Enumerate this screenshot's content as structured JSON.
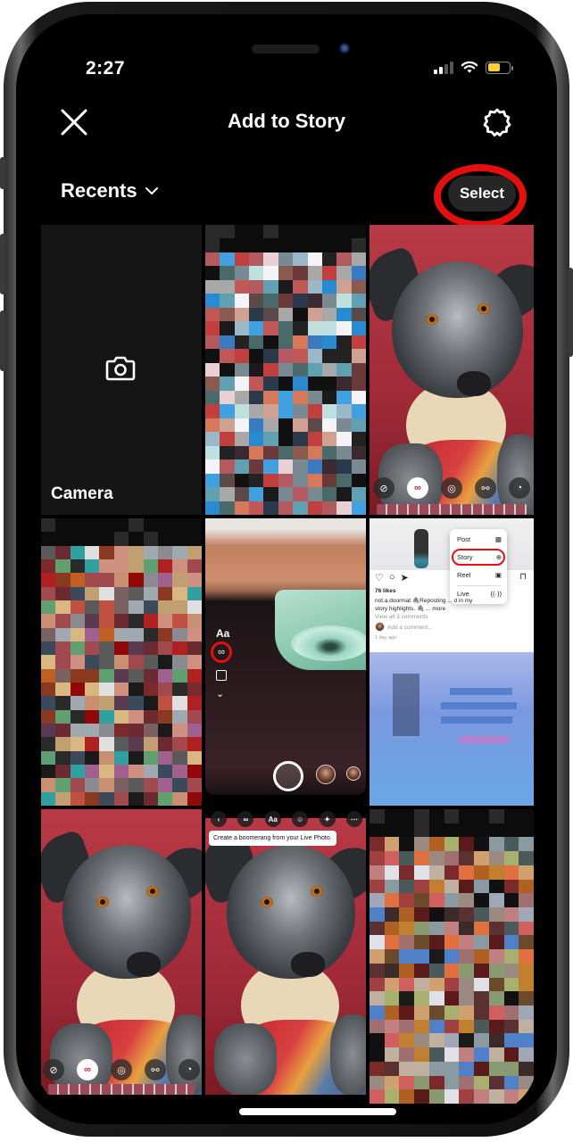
{
  "status_bar": {
    "time": "2:27",
    "signal_bars": 2,
    "signal_bars_total": 4,
    "wifi_icon": "wifi-icon",
    "battery_level": 0.6,
    "battery_color": "#f5d03b"
  },
  "header": {
    "close_icon": "close-icon",
    "title": "Add to Story",
    "settings_icon": "gear-icon"
  },
  "toolbar": {
    "album_label": "Recents",
    "album_chevron": "chevron-down-icon",
    "select_label": "Select",
    "highlight_color": "#e41010"
  },
  "grid": {
    "camera_tile": {
      "icon": "camera-icon",
      "label": "Camera"
    },
    "tiles": [
      {
        "id": "blurred-screenshot-1",
        "kind": "pixelated"
      },
      {
        "id": "dog-photo-1",
        "kind": "photo",
        "has_effect_bar": true
      },
      {
        "id": "blurred-screenshot-2",
        "kind": "pixelated"
      },
      {
        "id": "story-camera-screenshot",
        "kind": "screenshot"
      },
      {
        "id": "instagram-post-screenshot",
        "kind": "screenshot"
      },
      {
        "id": "dog-photo-2",
        "kind": "photo",
        "has_effect_bar": true
      },
      {
        "id": "dog-photo-tooltip",
        "kind": "screenshot"
      },
      {
        "id": "blurred-screenshot-3",
        "kind": "pixelated"
      }
    ],
    "effect_pills": [
      "⊘",
      "∞",
      "◎",
      "⚯",
      "◔"
    ],
    "story_camera": {
      "text_tool": "Aa",
      "boomerang_glyph": "∞",
      "chevron": "⌄"
    },
    "instagram_post": {
      "menu_items": [
        {
          "label": "Post",
          "icon": "grid-icon"
        },
        {
          "label": "Story",
          "icon": "story-plus-icon"
        },
        {
          "label": "Reel",
          "icon": "reel-icon"
        },
        {
          "label": "Live",
          "icon": "live-icon"
        }
      ],
      "likes": "76 likes",
      "caption_user": "not.a.doormat",
      "caption_line1": "not.a.doormat 🖇Reposting ... d in my",
      "caption_line2": "story highlights. 🖇 ... more",
      "comments_link": "View all 3 comments",
      "comment_placeholder": "Add a comment...",
      "time_ago": "1 day ago"
    },
    "boomerang_tooltip": {
      "icons": [
        "‹",
        "∞",
        "Aa",
        "☺",
        "✦",
        "⋯"
      ],
      "text": "Create a boomerang from your Live Photo."
    }
  }
}
